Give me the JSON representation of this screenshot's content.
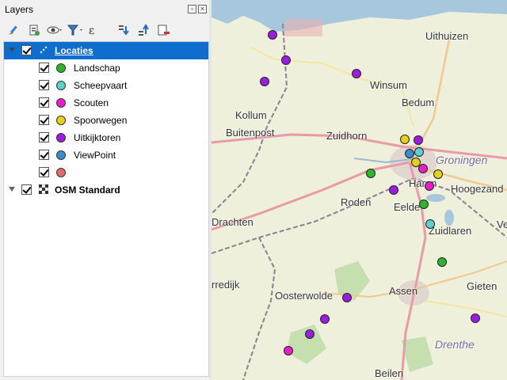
{
  "panel": {
    "title": "Layers"
  },
  "toolbar": {
    "icons": [
      "paint-brush-icon",
      "add-group-icon",
      "eye-icon",
      "filter-icon",
      "expression-filter-icon",
      "expand-all-icon",
      "collapse-all-icon",
      "remove-layer-icon"
    ]
  },
  "tree": {
    "group": {
      "label": "Locaties"
    },
    "items": [
      {
        "label": "Landschap",
        "color": "#2db52d"
      },
      {
        "label": "Scheepvaart",
        "color": "#5dd0d0"
      },
      {
        "label": "Scouten",
        "color": "#e81ec8"
      },
      {
        "label": "Spoorwegen",
        "color": "#e6d01e"
      },
      {
        "label": "Uitkijktoren",
        "color": "#9b1ee0"
      },
      {
        "label": "ViewPoint",
        "color": "#3a8ccc"
      },
      {
        "label": "",
        "color": "#e06a6a"
      }
    ],
    "basemap": {
      "label": "OSM Standard"
    }
  },
  "map": {
    "labels": [
      {
        "text": "Uithuizen",
        "cls": "city"
      },
      {
        "text": "Winsum",
        "cls": "city"
      },
      {
        "text": "Bedum",
        "cls": "city"
      },
      {
        "text": "Kollum",
        "cls": "city"
      },
      {
        "text": "Buitenpost",
        "cls": "city"
      },
      {
        "text": "Zuidhorn",
        "cls": "city"
      },
      {
        "text": "Groningen",
        "cls": "italic"
      },
      {
        "text": "Haren",
        "cls": "city"
      },
      {
        "text": "Hoogezand",
        "cls": "city"
      },
      {
        "text": "Roden",
        "cls": "city"
      },
      {
        "text": "Eelde",
        "cls": "city"
      },
      {
        "text": "Zuidlaren",
        "cls": "city"
      },
      {
        "text": "Drachten",
        "cls": "city"
      },
      {
        "text": "rredijk",
        "cls": "city"
      },
      {
        "text": "Oosterwolde",
        "cls": "city"
      },
      {
        "text": "Assen",
        "cls": "city"
      },
      {
        "text": "Gieten",
        "cls": "city"
      },
      {
        "text": "Drenthe",
        "cls": "italic"
      },
      {
        "text": "Beilen",
        "cls": "city"
      },
      {
        "text": "Ve",
        "cls": "city"
      }
    ]
  }
}
